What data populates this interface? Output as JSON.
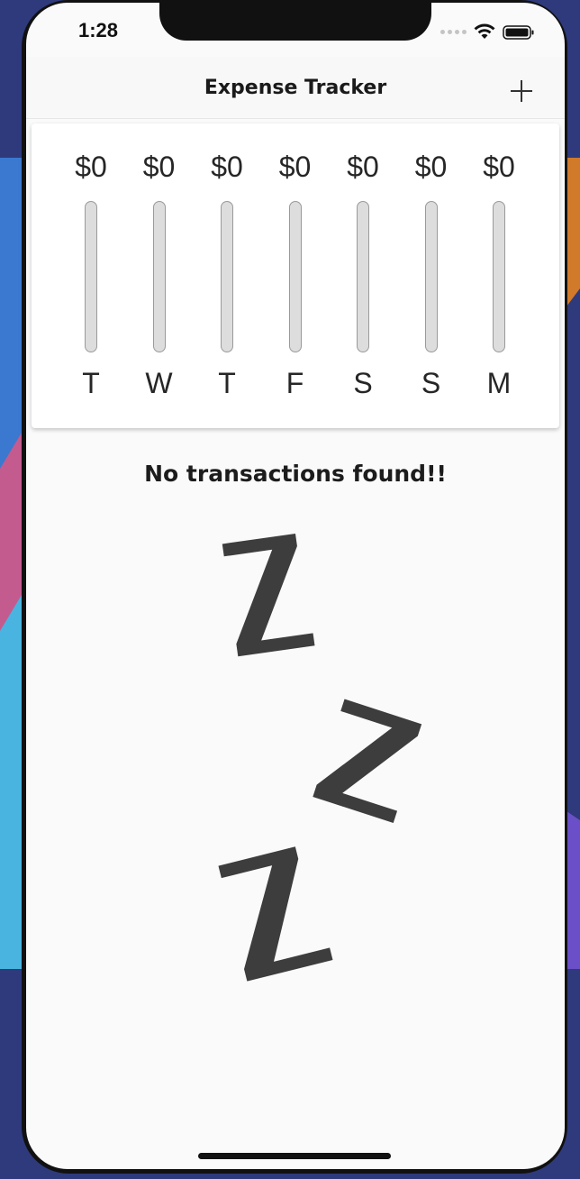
{
  "status_bar": {
    "time": "1:28"
  },
  "app_bar": {
    "title": "Expense Tracker",
    "add_icon": "plus-icon"
  },
  "chart_data": {
    "type": "bar",
    "categories": [
      "T",
      "W",
      "T",
      "F",
      "S",
      "S",
      "M"
    ],
    "values": [
      0,
      0,
      0,
      0,
      0,
      0,
      0
    ],
    "value_labels": [
      "$0",
      "$0",
      "$0",
      "$0",
      "$0",
      "$0",
      "$0"
    ],
    "fill_fraction": [
      0,
      0,
      0,
      0,
      0,
      0,
      0
    ]
  },
  "empty_state": {
    "message": "No transactions found!!",
    "illustration_icon": "sleeping-zzz-icon"
  },
  "colors": {
    "background": "#fafafa",
    "bar_track": "#dddddd",
    "text": "#262626"
  }
}
